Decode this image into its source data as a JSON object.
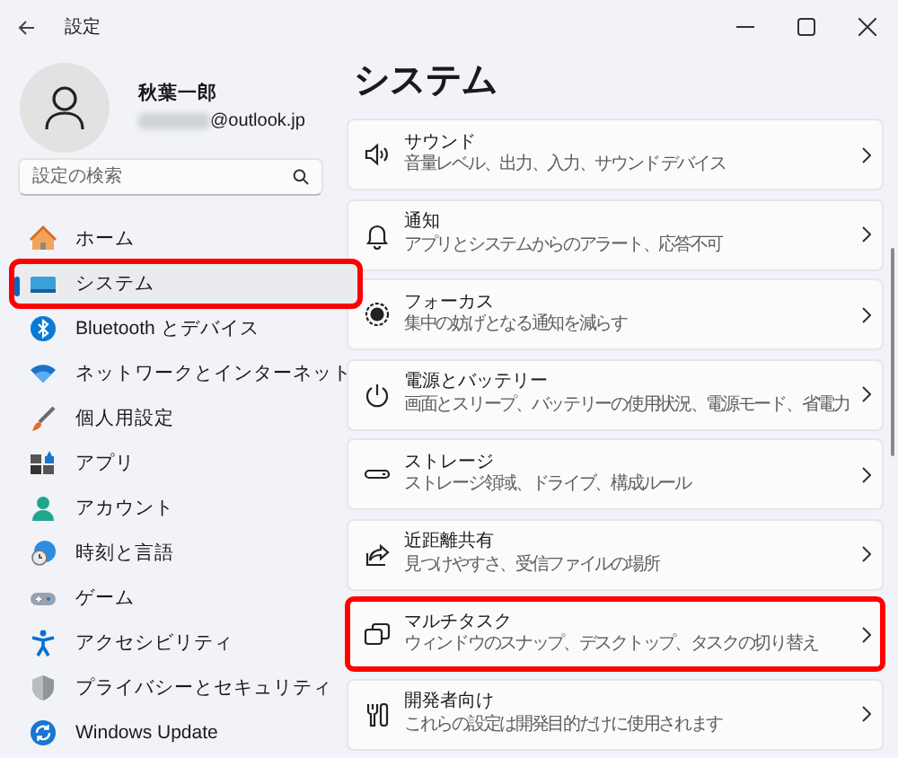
{
  "window": {
    "title": "設定"
  },
  "profile": {
    "name": "秋葉一郎",
    "email": "@outlook.jp"
  },
  "search": {
    "placeholder": "設定の検索"
  },
  "sidebar": {
    "items": [
      {
        "label": "ホーム",
        "selected": false,
        "highlighted": false
      },
      {
        "label": "システム",
        "selected": true,
        "highlighted": true
      },
      {
        "label": "Bluetooth とデバイス",
        "selected": false,
        "highlighted": false
      },
      {
        "label": "ネットワークとインターネット",
        "selected": false,
        "highlighted": false
      },
      {
        "label": "個人用設定",
        "selected": false,
        "highlighted": false
      },
      {
        "label": "アプリ",
        "selected": false,
        "highlighted": false
      },
      {
        "label": "アカウント",
        "selected": false,
        "highlighted": false
      },
      {
        "label": "時刻と言語",
        "selected": false,
        "highlighted": false
      },
      {
        "label": "ゲーム",
        "selected": false,
        "highlighted": false
      },
      {
        "label": "アクセシビリティ",
        "selected": false,
        "highlighted": false
      },
      {
        "label": "プライバシーとセキュリティ",
        "selected": false,
        "highlighted": false
      },
      {
        "label": "Windows Update",
        "selected": false,
        "highlighted": false
      }
    ]
  },
  "page": {
    "title": "システム",
    "cards": [
      {
        "title": "サウンド",
        "subtitle": "音量レベル、出力、入力、サウンド デバイス",
        "highlighted": false
      },
      {
        "title": "通知",
        "subtitle": "アプリとシステムからのアラート、応答不可",
        "highlighted": false
      },
      {
        "title": "フォーカス",
        "subtitle": "集中の妨げとなる通知を減らす",
        "highlighted": false
      },
      {
        "title": "電源とバッテリー",
        "subtitle": "画面とスリープ、バッテリーの使用状況、電源モード、省電力",
        "highlighted": false
      },
      {
        "title": "ストレージ",
        "subtitle": "ストレージ領域、ドライブ、構成ルール",
        "highlighted": false
      },
      {
        "title": "近距離共有",
        "subtitle": "見つけやすさ、受信ファイルの場所",
        "highlighted": false
      },
      {
        "title": "マルチタスク",
        "subtitle": "ウィンドウのスナップ、デスクトップ、タスクの切り替え",
        "highlighted": true
      },
      {
        "title": "開発者向け",
        "subtitle": "これらの設定は開発目的だけに使用されます",
        "highlighted": false
      }
    ]
  }
}
